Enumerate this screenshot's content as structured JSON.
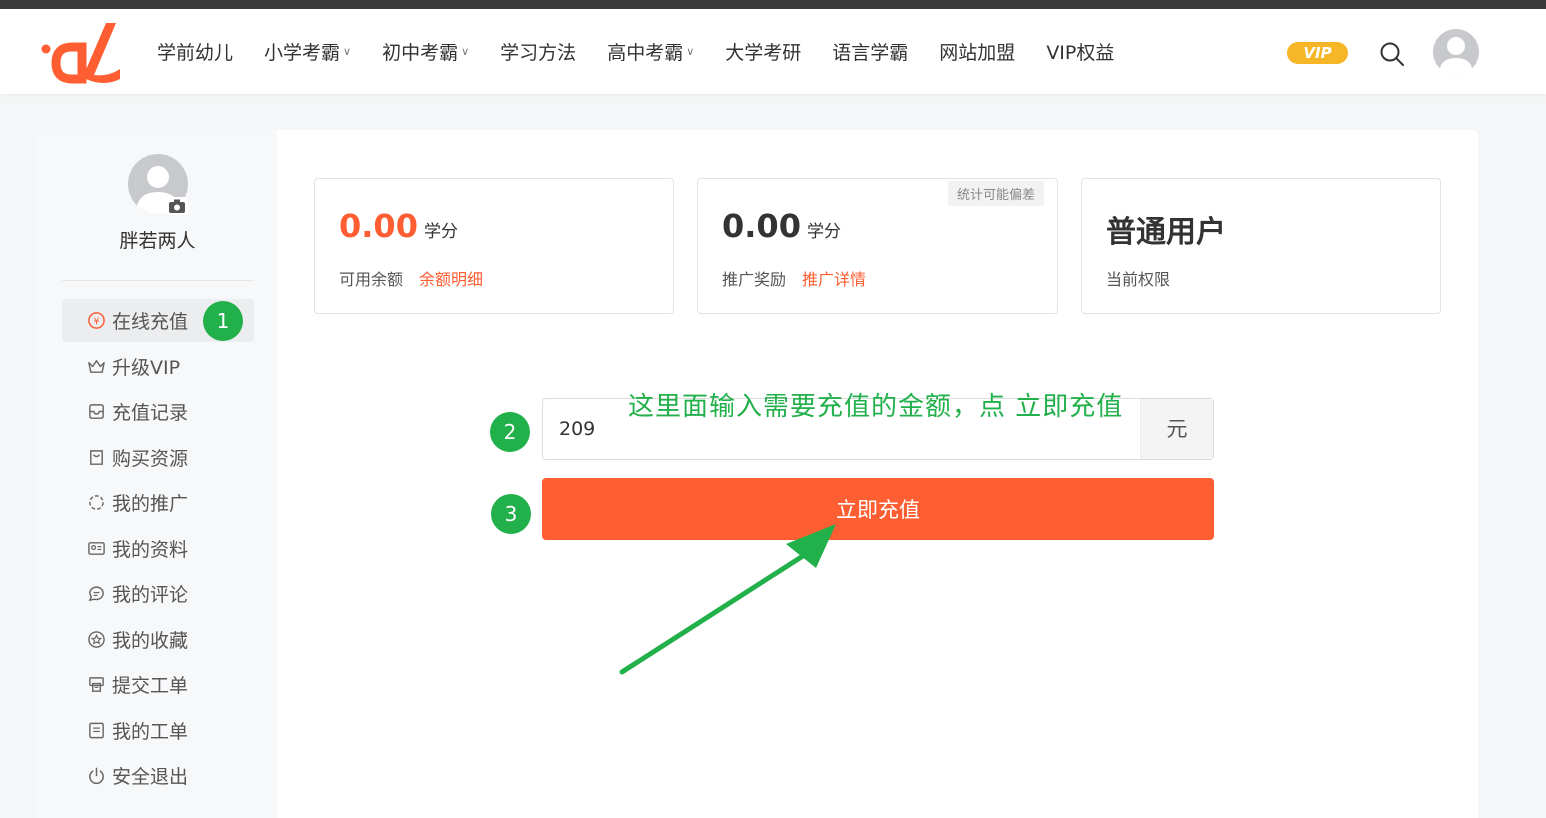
{
  "header": {
    "nav": [
      {
        "label": "学前幼儿",
        "dropdown": false
      },
      {
        "label": "小学考霸",
        "dropdown": true
      },
      {
        "label": "初中考霸",
        "dropdown": true
      },
      {
        "label": "学习方法",
        "dropdown": false
      },
      {
        "label": "高中考霸",
        "dropdown": true
      },
      {
        "label": "大学考研",
        "dropdown": false
      },
      {
        "label": "语言学霸",
        "dropdown": false
      },
      {
        "label": "网站加盟",
        "dropdown": false
      },
      {
        "label": "VIP权益",
        "dropdown": false
      }
    ],
    "vip_badge": "VIP",
    "brand_color": "#fe5e32",
    "vip_color": "#f7b628"
  },
  "sidebar": {
    "username": "胖若两人",
    "menu": [
      {
        "label": "在线充值",
        "icon": "yuan-circle-icon",
        "active": true
      },
      {
        "label": "升级VIP",
        "icon": "crown-icon",
        "active": false
      },
      {
        "label": "充值记录",
        "icon": "record-icon",
        "active": false
      },
      {
        "label": "购买资源",
        "icon": "shopping-bag-icon",
        "active": false
      },
      {
        "label": "我的推广",
        "icon": "spinner-icon",
        "active": false
      },
      {
        "label": "我的资料",
        "icon": "id-card-icon",
        "active": false
      },
      {
        "label": "我的评论",
        "icon": "comment-icon",
        "active": false
      },
      {
        "label": "我的收藏",
        "icon": "star-circle-icon",
        "active": false
      },
      {
        "label": "提交工单",
        "icon": "printer-icon",
        "active": false
      },
      {
        "label": "我的工单",
        "icon": "ticket-icon",
        "active": false
      },
      {
        "label": "安全退出",
        "icon": "power-icon",
        "active": false
      }
    ]
  },
  "stats": {
    "balance": {
      "value": "0.00",
      "unit": "学分",
      "label": "可用余额",
      "link": "余额明细"
    },
    "promotion": {
      "value": "0.00",
      "unit": "学分",
      "label": "推广奖励",
      "link": "推广详情",
      "note": "统计可能偏差"
    },
    "level": {
      "value": "普通用户",
      "label": "当前权限"
    }
  },
  "recharge": {
    "amount": "209",
    "unit": "元",
    "button_label": "立即充值"
  },
  "annotations": {
    "steps": [
      "1",
      "2",
      "3"
    ],
    "instruction": "这里面输入需要充值的金额，点  立即充值",
    "color": "#22b04b"
  }
}
